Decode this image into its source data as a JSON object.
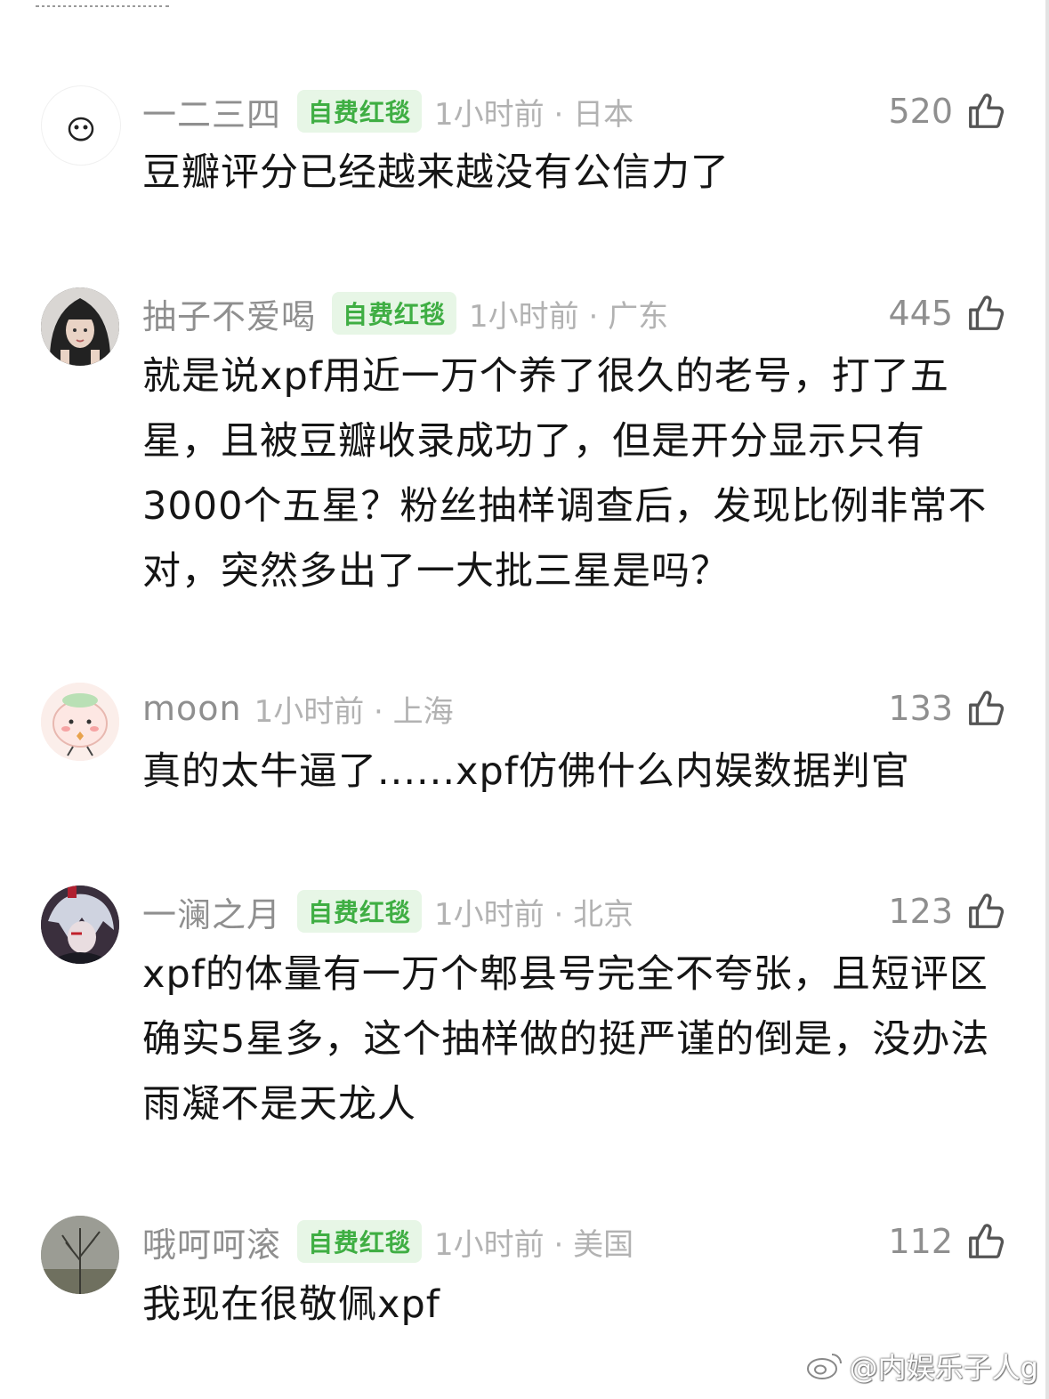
{
  "comments": [
    {
      "name": "一二三四",
      "badge": "自费红毯",
      "meta": "1小时前 · 日本",
      "likes": "520",
      "text": "豆瓣评分已经越来越没有公信力了",
      "avatar_icon": "cartoon-face-avatar"
    },
    {
      "name": "抽子不爱喝",
      "badge": "自费红毯",
      "meta": "1小时前 · 广东",
      "likes": "445",
      "text": "就是说xpf用近一万个养了很久的老号，打了五星，且被豆瓣收录成功了，但是开分显示只有3000个五星？粉丝抽样调查后，发现比例非常不对，突然多出了一大批三星是吗？",
      "avatar_icon": "portrait-avatar"
    },
    {
      "name": "moon",
      "badge": "",
      "meta": "1小时前 · 上海",
      "likes": "133",
      "text": "真的太牛逼了......xpf仿佛什么内娱数据判官",
      "avatar_icon": "pink-cartoon-avatar"
    },
    {
      "name": "一澜之月",
      "badge": "自费红毯",
      "meta": "1小时前 · 北京",
      "likes": "123",
      "text": "xpf的体量有一万个郫县号完全不夸张，且短评区确实5星多，这个抽样做的挺严谨的倒是，没办法雨凝不是天龙人",
      "avatar_icon": "anime-character-avatar"
    },
    {
      "name": "哦呵呵滚",
      "badge": "自费红毯",
      "meta": "1小时前 · 美国",
      "likes": "112",
      "text": "我现在很敬佩xpf",
      "avatar_icon": "tree-photo-avatar"
    }
  ],
  "watermark": "@内娱乐子人g",
  "colors": {
    "badge_bg": "#e7f6e6",
    "badge_text": "#3fae43",
    "name": "#8f8f8f",
    "meta": "#b2b2b2"
  }
}
